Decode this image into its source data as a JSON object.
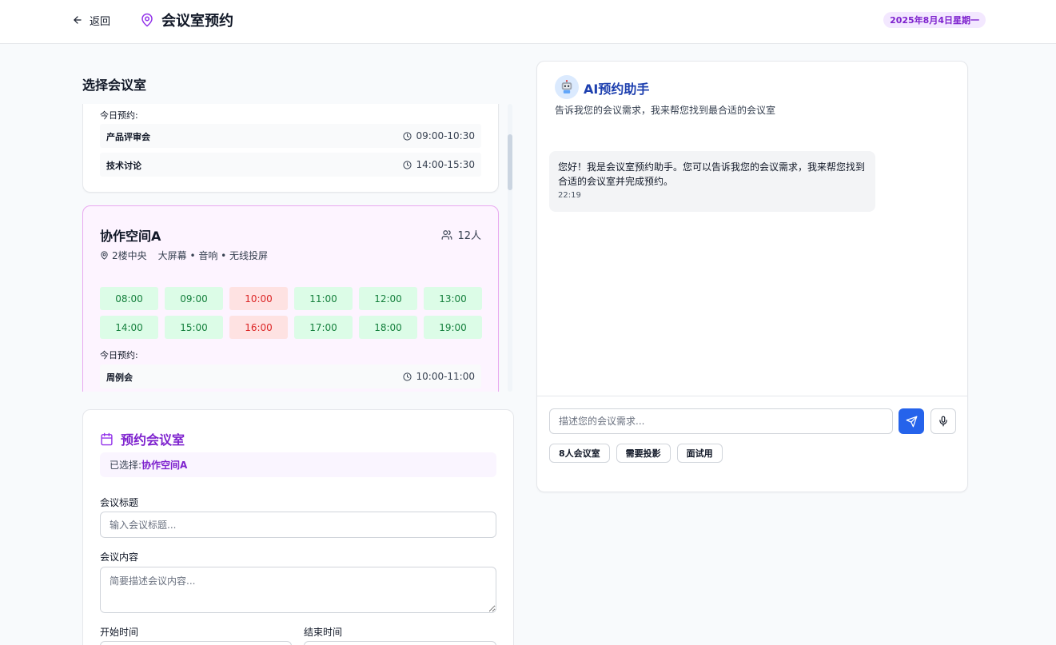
{
  "header": {
    "back_label": "返回",
    "title": "会议室预约",
    "date": "2025年8月4日星期一"
  },
  "rooms_section": {
    "title": "选择会议室",
    "rooms": [
      {
        "name": "",
        "today_label": "今日预约:",
        "bookings": [
          {
            "title": "产品评审会",
            "time": "09:00-10:30"
          },
          {
            "title": "技术讨论",
            "time": "14:00-15:30"
          }
        ]
      },
      {
        "name": "协作空间A",
        "capacity": "12人",
        "location": "2楼中央",
        "equipment": "大屏幕 • 音响 • 无线投屏",
        "slots": [
          {
            "time": "08:00",
            "status": "free"
          },
          {
            "time": "09:00",
            "status": "free"
          },
          {
            "time": "10:00",
            "status": "busy"
          },
          {
            "time": "11:00",
            "status": "free"
          },
          {
            "time": "12:00",
            "status": "free"
          },
          {
            "time": "13:00",
            "status": "free"
          },
          {
            "time": "14:00",
            "status": "free"
          },
          {
            "time": "15:00",
            "status": "free"
          },
          {
            "time": "16:00",
            "status": "busy"
          },
          {
            "time": "17:00",
            "status": "free"
          },
          {
            "time": "18:00",
            "status": "free"
          },
          {
            "time": "19:00",
            "status": "free"
          }
        ],
        "today_label": "今日预约:",
        "bookings": [
          {
            "title": "周例会",
            "time": "10:00-11:00"
          }
        ]
      }
    ]
  },
  "booking_form": {
    "title": "预约会议室",
    "selected_prefix": "已选择:",
    "selected_room": "协作空间A",
    "title_label": "会议标题",
    "title_placeholder": "输入会议标题...",
    "content_label": "会议内容",
    "content_placeholder": "简要描述会议内容...",
    "start_label": "开始时间",
    "end_label": "结束时间"
  },
  "assistant": {
    "title": "AI预约助手",
    "subtitle": "告诉我您的会议需求，我来帮您找到最合适的会议室",
    "messages": [
      {
        "text": "您好！我是会议室预约助手。您可以告诉我您的会议需求，我来帮您找到合适的会议室并完成预约。",
        "time": "22:19"
      }
    ],
    "input_placeholder": "描述您的会议需求...",
    "chips": [
      "8人会议室",
      "需要投影",
      "面试用"
    ]
  },
  "colors": {
    "accent_purple": "#7e22ce",
    "accent_blue": "#2563eb",
    "slot_free": "#dcfce7",
    "slot_busy": "#fee2e2"
  }
}
